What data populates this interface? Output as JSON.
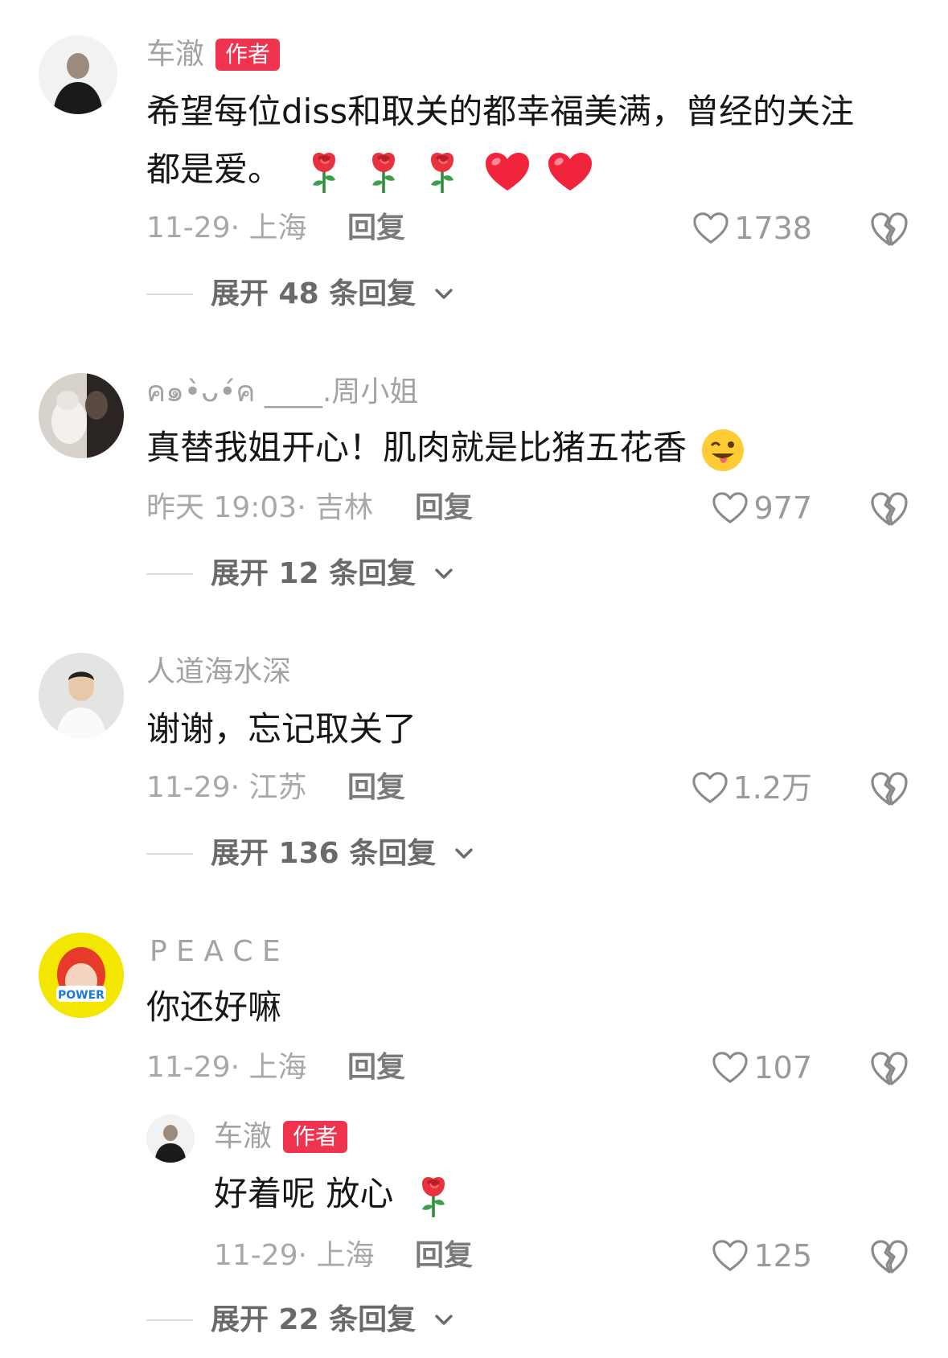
{
  "comments": [
    {
      "username": "车澈",
      "badge": "作者",
      "text_line1": "希望每位diss和取关的都幸福美满，曾经的关注",
      "text_line2": "都是爱。",
      "meta": "11-29· 上海",
      "reply_label": "回复",
      "like_count": "1738",
      "expand_label": "展开 48 条回复"
    },
    {
      "username": "ค๑•̀ᴗ•́ค ____.周小姐",
      "text": "真替我姐开心！肌肉就是比猪五花香",
      "meta": "昨天 19:03· 吉林",
      "reply_label": "回复",
      "like_count": "977",
      "expand_label": "展开 12 条回复"
    },
    {
      "username": "人道海水深",
      "text": "谢谢，忘记取关了",
      "meta": "11-29· 江苏",
      "reply_label": "回复",
      "like_count": "1.2万",
      "expand_label": "展开 136 条回复"
    },
    {
      "username": "P E A C E",
      "text": "你还好嘛",
      "meta": "11-29· 上海",
      "reply_label": "回复",
      "like_count": "107",
      "sub_reply": {
        "username": "车澈",
        "badge": "作者",
        "text": "好着呢 放心",
        "meta": "11-29· 上海",
        "reply_label": "回复",
        "like_count": "125"
      },
      "expand_label": "展开 22 条回复"
    }
  ],
  "icons": {
    "like": "heart-outline-icon",
    "dislike": "broken-heart-icon",
    "expand": "chevron-down-icon",
    "rose": "rose-emoji",
    "heart": "red-heart-emoji",
    "wink": "winking-tongue-emoji"
  },
  "colors": {
    "badge": "#f0334f",
    "text": "#161616",
    "muted": "#a3a3a3",
    "heart": "#ee2b45"
  }
}
